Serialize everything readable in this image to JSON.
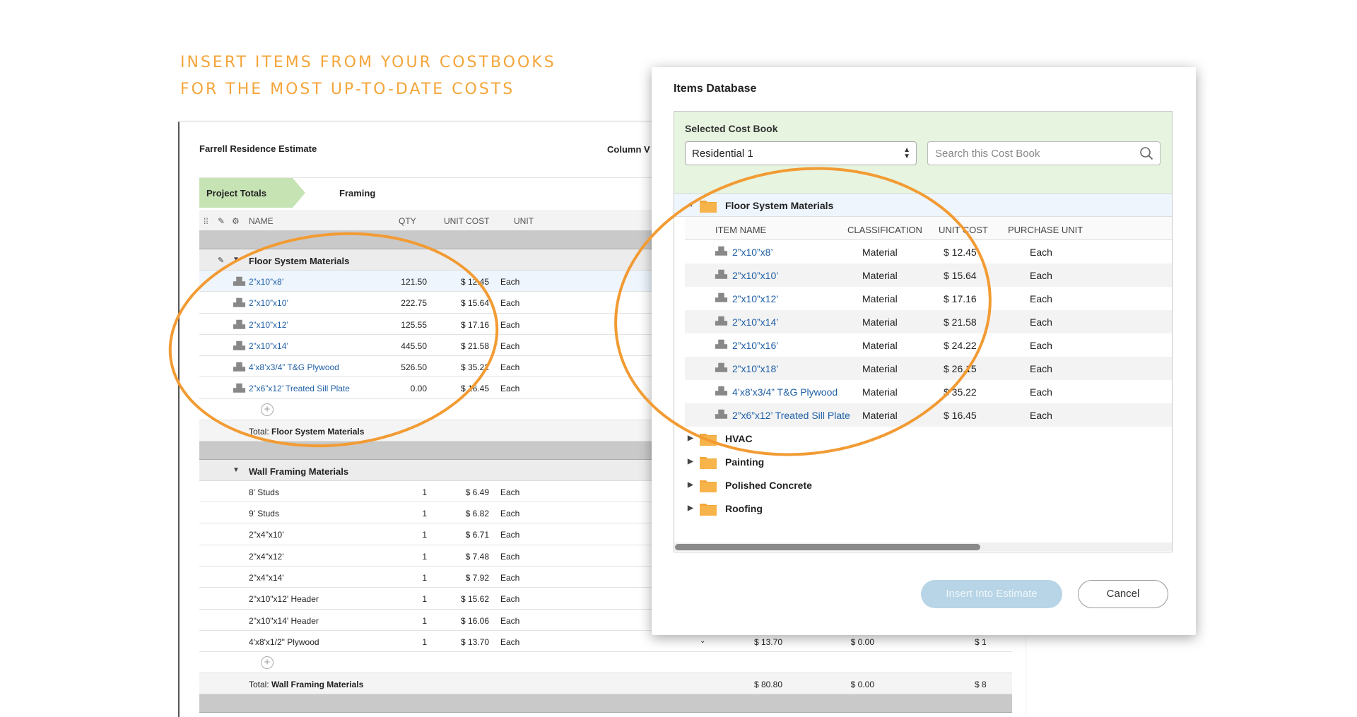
{
  "headline": {
    "line1": "Insert items from your costbooks",
    "line2": "for the most up-to-date costs"
  },
  "estimate": {
    "title": "Farrell Residence Estimate",
    "column_view_label": "Column V",
    "breadcrumb": {
      "active": "Project Totals",
      "current": "Framing"
    },
    "columns": {
      "name": "NAME",
      "qty": "QTY",
      "unit_cost": "UNIT COST",
      "unit": "UNIT"
    },
    "groups": [
      {
        "name": "Floor System Materials",
        "rows": [
          {
            "name": "2”x10”x8’",
            "qty": "121.50",
            "unit_cost": "$ 12.45",
            "unit": "Each"
          },
          {
            "name": "2”x10”x10’",
            "qty": "222.75",
            "unit_cost": "$ 15.64",
            "unit": "Each"
          },
          {
            "name": "2”x10”x12’",
            "qty": "125.55",
            "unit_cost": "$ 17.16",
            "unit": "Each"
          },
          {
            "name": "2”x10”x14’",
            "qty": "445.50",
            "unit_cost": "$ 21.58",
            "unit": "Each"
          },
          {
            "name": "4’x8’x3/4” T&G Plywood",
            "qty": "526.50",
            "unit_cost": "$ 35.22",
            "unit": "Each"
          },
          {
            "name": "2”x6”x12’ Treated Sill Plate",
            "qty": "0.00",
            "unit_cost": "$ 16.45",
            "unit": "Each"
          }
        ],
        "total_prefix": "Total:",
        "total_name": "Floor System Materials"
      },
      {
        "name": "Wall Framing Materials",
        "rows": [
          {
            "name": "8' Studs",
            "qty": "1",
            "unit_cost": "$ 6.49",
            "unit": "Each"
          },
          {
            "name": "9' Studs",
            "qty": "1",
            "unit_cost": "$ 6.82",
            "unit": "Each"
          },
          {
            "name": "2\"x4\"x10'",
            "qty": "1",
            "unit_cost": "$ 6.71",
            "unit": "Each"
          },
          {
            "name": "2\"x4\"x12'",
            "qty": "1",
            "unit_cost": "$ 7.48",
            "unit": "Each"
          },
          {
            "name": "2\"x4\"x14'",
            "qty": "1",
            "unit_cost": "$ 7.92",
            "unit": "Each"
          },
          {
            "name": "2\"x10\"x12' Header",
            "qty": "1",
            "unit_cost": "$ 15.62",
            "unit": "Each"
          },
          {
            "name": "2\"x10\"x14' Header",
            "qty": "1",
            "unit_cost": "$ 16.06",
            "unit": "Each"
          },
          {
            "name": "4'x8'x1/2\" Plywood",
            "qty": "1",
            "unit_cost": "$ 13.70",
            "unit": "Each",
            "c1": "$ 13.70",
            "c2": "$ 0.00",
            "c3": "$ 1"
          }
        ],
        "total_prefix": "Total:",
        "total_name": "Wall Framing Materials",
        "total_c1": "$ 80.80",
        "total_c2": "$ 0.00",
        "total_c3": "$ 8"
      }
    ]
  },
  "dialog": {
    "title": "Items Database",
    "selected_label": "Selected Cost Book",
    "selected_value": "Residential 1",
    "search_placeholder": "Search this Cost Book",
    "open_folder": "Floor System Materials",
    "columns": {
      "name": "ITEM NAME",
      "classification": "CLASSIFICATION",
      "unit_cost": "UNIT COST",
      "purchase_unit": "PURCHASE UNIT"
    },
    "items": [
      {
        "name": "2”x10”x8’",
        "classification": "Material",
        "unit_cost": "$ 12.45",
        "purchase_unit": "Each"
      },
      {
        "name": "2”x10”x10’",
        "classification": "Material",
        "unit_cost": "$ 15.64",
        "purchase_unit": "Each"
      },
      {
        "name": "2”x10”x12’",
        "classification": "Material",
        "unit_cost": "$ 17.16",
        "purchase_unit": "Each"
      },
      {
        "name": "2”x10”x14’",
        "classification": "Material",
        "unit_cost": "$ 21.58",
        "purchase_unit": "Each"
      },
      {
        "name": "2”x10”x16’",
        "classification": "Material",
        "unit_cost": "$ 24.22",
        "purchase_unit": "Each"
      },
      {
        "name": "2”x10”x18’",
        "classification": "Material",
        "unit_cost": "$ 26.15",
        "purchase_unit": "Each"
      },
      {
        "name": "4’x8’x3/4” T&G Plywood",
        "classification": "Material",
        "unit_cost": "$ 35.22",
        "purchase_unit": "Each"
      },
      {
        "name": "2”x6”x12’ Treated Sill Plate",
        "classification": "Material",
        "unit_cost": "$ 16.45",
        "purchase_unit": "Each"
      }
    ],
    "folders": [
      "HVAC",
      "Painting",
      "Polished Concrete",
      "Roofing"
    ],
    "insert_label": "Insert Into Estimate",
    "cancel_label": "Cancel"
  },
  "colors": {
    "accent_orange": "#f29b33",
    "link_blue": "#1f5fa6",
    "panel_green": "#e7f4df",
    "breadcrumb_green": "#c5e3b3"
  },
  "icons": [
    "item-icon",
    "folder-icon",
    "search-icon",
    "note-icon",
    "gear-icon",
    "add-icon"
  ]
}
